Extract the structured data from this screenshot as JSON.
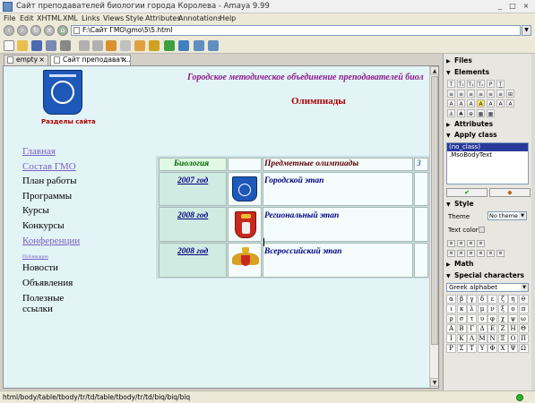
{
  "window": {
    "title": "Сайт преподавателей биологии города Королева - Amaya 9.99",
    "minimize": "_",
    "maximize": "□",
    "close": "×"
  },
  "menu": [
    "File",
    "Edit",
    "XHTML",
    "XML",
    "Links",
    "Views",
    "Style",
    "Attributes",
    "Annotations",
    "Help"
  ],
  "address": {
    "value": "F:\\Сайт ГМО\\gmo\\5\\5.html"
  },
  "tabs": [
    {
      "label": "empty",
      "close": "×"
    },
    {
      "label": "Сайт преподават...",
      "close": "×"
    }
  ],
  "page": {
    "org_title": "Городское методическое объединение преподавателей биол",
    "heading": "Олимпиады",
    "sections_label": "Разделы сайта",
    "nav": [
      {
        "label": "Главная",
        "style": "purple"
      },
      {
        "label": "Состав ГМО",
        "style": "purple"
      },
      {
        "label": "План работы",
        "style": "black"
      },
      {
        "label": "Программы",
        "style": "black"
      },
      {
        "label": "Курсы",
        "style": "black"
      },
      {
        "label": "Конкурсы",
        "style": "black"
      },
      {
        "label": "Конференции",
        "style": "purple"
      },
      {
        "label": "Публикации",
        "style": "tiny"
      },
      {
        "label": "Новости",
        "style": "black"
      },
      {
        "label": "Объявления",
        "style": "black"
      },
      {
        "label": "Полезные",
        "style": "black"
      },
      {
        "label": "ссылки",
        "style": "black"
      }
    ],
    "table": {
      "head_bio": "Биология",
      "head_title": "Предметные олимпиады",
      "head_third": "З",
      "rows": [
        {
          "year": "2007 год",
          "stage": "Городской этап"
        },
        {
          "year": "2008 год",
          "stage": "Региональный этап"
        },
        {
          "year": "2008 год",
          "stage": "Всероссийский этап"
        }
      ]
    }
  },
  "status": {
    "path": "html/body/table/tbody/tr/td/table/tbody/tr/td/biq/biq/biq"
  },
  "panel": {
    "files": "Files",
    "elements": "Elements",
    "attributes": "Attributes",
    "apply_class": "Apply class",
    "classes": [
      "(no_class)",
      ".MsoBodyText"
    ],
    "style": "Style",
    "theme_label": "Theme",
    "theme_value": "No theme",
    "text_color_label": "Text color",
    "math": "Math",
    "special_chars": "Special characters",
    "greek_select": "Greek alphabet",
    "element_buttons": [
      "T",
      "T₁",
      "T₁",
      "Tₓ",
      "P",
      "T̲",
      "≡",
      "≡",
      "≡",
      "≡",
      "≡",
      "≡",
      "⊞",
      "A",
      "A",
      "A",
      "A",
      "A",
      "A",
      "A",
      "⚓",
      "♣",
      "⊕",
      "▦",
      "▦"
    ],
    "greek": [
      "α",
      "β",
      "γ",
      "δ",
      "ε",
      "ζ",
      "η",
      "θ",
      "ι",
      "κ",
      "λ",
      "μ",
      "ν",
      "ξ",
      "ο",
      "π",
      "ρ",
      "σ",
      "τ",
      "υ",
      "φ",
      "χ",
      "ψ",
      "ω",
      "Α",
      "Β",
      "Γ",
      "Δ",
      "Ε",
      "Ζ",
      "Η",
      "Θ",
      "Ι",
      "Κ",
      "Λ",
      "Μ",
      "Ν",
      "Ξ",
      "Ο",
      "Π",
      "Ρ",
      "Σ",
      "Τ",
      "Υ",
      "Φ",
      "Χ",
      "Ψ",
      "Ω"
    ]
  }
}
